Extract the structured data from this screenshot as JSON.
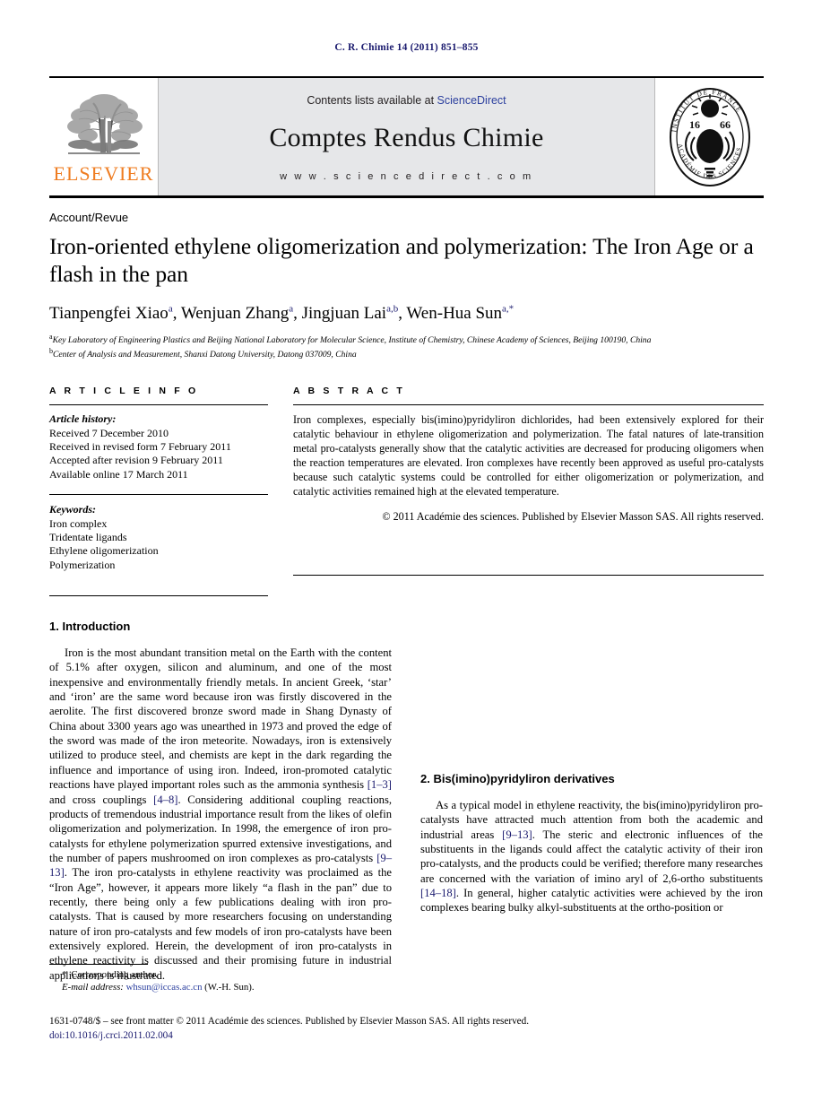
{
  "running_head": "C. R. Chimie 14 (2011) 851–855",
  "masthead": {
    "contents_prefix": "Contents lists available at ",
    "sciencedirect": "ScienceDirect",
    "journal_title": "Comptes Rendus Chimie",
    "url": "w w w . s c i e n c e d i r e c t . c o m",
    "elsevier_wordmark": "ELSEVIER",
    "seal_top": "INSTITUT DE FRANCE",
    "seal_bottom": "ACADÉMIE DES SCIENCES",
    "seal_year": "1666"
  },
  "article": {
    "type": "Account/Revue",
    "title": "Iron-oriented ethylene oligomerization and polymerization: The Iron Age or a flash in the pan",
    "authors_html": "Tianpengfei Xiao a, Wenjuan Zhang a, Jingjuan Lai a,b, Wen-Hua Sun a,*",
    "authors": [
      {
        "name": "Tianpengfei Xiao",
        "marks": "a"
      },
      {
        "name": "Wenjuan Zhang",
        "marks": "a"
      },
      {
        "name": "Jingjuan Lai",
        "marks": "a,b"
      },
      {
        "name": "Wen-Hua Sun",
        "marks": "a,*"
      }
    ],
    "affiliations": [
      {
        "mark": "a",
        "text": "Key Laboratory of Engineering Plastics and Beijing National Laboratory for Molecular Science, Institute of Chemistry, Chinese Academy of Sciences, Beijing 100190, China"
      },
      {
        "mark": "b",
        "text": "Center of Analysis and Measurement, Shanxi Datong University, Datong 037009, China"
      }
    ]
  },
  "info": {
    "heading": "A R T I C L E   I N F O",
    "history_label": "Article history:",
    "history": [
      "Received 7 December 2010",
      "Received in revised form 7 February 2011",
      "Accepted after revision 9 February 2011",
      "Available online 17 March 2011"
    ],
    "keywords_label": "Keywords:",
    "keywords": [
      "Iron complex",
      "Tridentate ligands",
      "Ethylene oligomerization",
      "Polymerization"
    ]
  },
  "abstract": {
    "heading": "A B S T R A C T",
    "text": "Iron complexes, especially bis(imino)pyridyliron dichlorides, had been extensively explored for their catalytic behaviour in ethylene oligomerization and polymerization. The fatal natures of late-transition metal pro-catalysts generally show that the catalytic activities are decreased for producing oligomers when the reaction temperatures are elevated. Iron complexes have recently been approved as useful pro-catalysts because such catalytic systems could be controlled for either oligomerization or polymerization, and catalytic activities remained high at the elevated temperature.",
    "copyright": "© 2011 Académie des sciences. Published by Elsevier Masson SAS. All rights reserved."
  },
  "sections": {
    "intro_heading": "1. Introduction",
    "intro_p1_a": "Iron is the most abundant transition metal on the Earth with the content of 5.1% after oxygen, silicon and aluminum, and one of the most inexpensive and environmentally friendly metals. In ancient Greek, ‘star’ and ‘iron’ are the same word because iron was firstly discovered in the aerolite. The first discovered bronze sword made in Shang Dynasty of China about 3300 years ago was unearthed in 1973 and proved the edge of the sword was made of the iron meteorite. Nowadays, iron is extensively utilized to produce steel, and chemists are kept in the dark regarding the influence and importance of using iron. Indeed, iron-promoted catalytic reactions have played important roles such as the ammonia synthesis ",
    "ref_1_3": "[1–3]",
    "intro_p1_b": " and cross couplings ",
    "ref_4_8": "[4–8]",
    "intro_p1_c": ". Considering additional coupling reactions, products of tremendous industrial importance result from the likes of olefin oligomerization and polymerization. In 1998, the emergence of iron pro-catalysts for ethylene polymerization spurred extensive investigations, and the number of papers mushroomed on iron complexes as pro-catalysts ",
    "ref_9_13": "[9–13]",
    "intro_p1_d": ". The iron pro-catalysts in ethylene reactivity was proclaimed as the “Iron Age”, however, it appears more likely “a flash in the pan” due to recently, there being only a few publications dealing with iron pro-catalysts. That is caused by more researchers focusing on understanding nature of iron pro-catalysts and few models of iron pro-catalysts have been extensively explored. Herein, the development of iron pro-catalysts in ethylene reactivity is discussed and their promising future in industrial applications is illustrated.",
    "sec2_heading": "2. Bis(imino)pyridyliron derivatives",
    "sec2_p1_a": "As a typical model in ethylene reactivity, the bis(imino)pyridyliron pro-catalysts have attracted much attention from both the academic and industrial areas ",
    "ref_9_13_b": "[9–13]",
    "sec2_p1_b": ". The steric and electronic influences of the substituents in the ligands could affect the catalytic activity of their iron pro-catalysts, and the products could be verified; therefore many researches are concerned with the variation of imino aryl of 2,6-ortho substituents ",
    "ref_14_18": "[14–18]",
    "sec2_p1_c": ". In general, higher catalytic activities were achieved by the iron complexes bearing bulky alkyl-substituents at the ortho-position or"
  },
  "footnote": {
    "corresponding": "Corresponding author.",
    "email_label": "E-mail address:",
    "email": "whsun@iccas.ac.cn",
    "email_owner": "(W.-H. Sun)."
  },
  "footer": {
    "issn_line": "1631-0748/$ – see front matter © 2011 Académie des sciences. Published by Elsevier Masson SAS. All rights reserved.",
    "doi": "doi:10.1016/j.crci.2011.02.004"
  }
}
